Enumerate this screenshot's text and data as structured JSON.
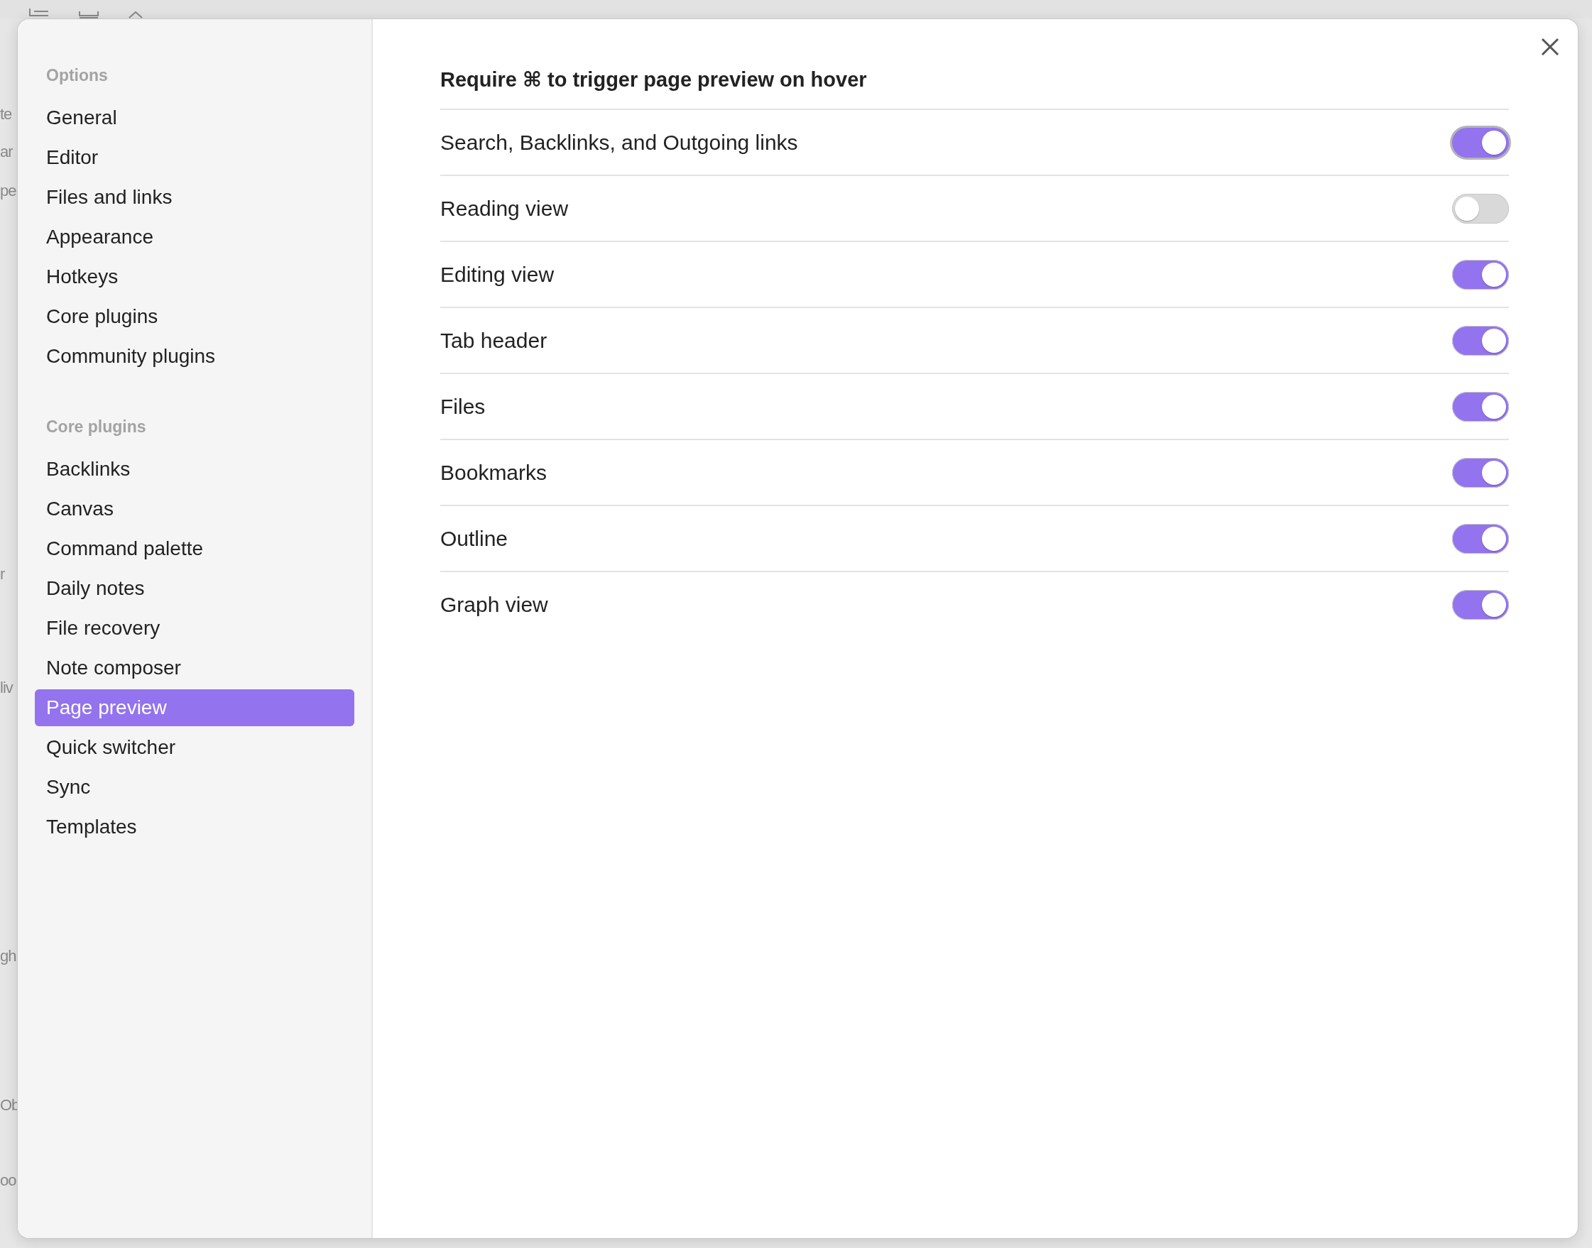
{
  "background": {
    "text_fragments": [
      "te",
      "ar",
      "pe",
      "r",
      "liv",
      "gh",
      "Ob",
      "oo"
    ]
  },
  "sidebar": {
    "sections": [
      {
        "title": "Options",
        "items": [
          {
            "label": "General",
            "selected": false
          },
          {
            "label": "Editor",
            "selected": false
          },
          {
            "label": "Files and links",
            "selected": false
          },
          {
            "label": "Appearance",
            "selected": false
          },
          {
            "label": "Hotkeys",
            "selected": false
          },
          {
            "label": "Core plugins",
            "selected": false
          },
          {
            "label": "Community plugins",
            "selected": false
          }
        ]
      },
      {
        "title": "Core plugins",
        "items": [
          {
            "label": "Backlinks",
            "selected": false
          },
          {
            "label": "Canvas",
            "selected": false
          },
          {
            "label": "Command palette",
            "selected": false
          },
          {
            "label": "Daily notes",
            "selected": false
          },
          {
            "label": "File recovery",
            "selected": false
          },
          {
            "label": "Note composer",
            "selected": false
          },
          {
            "label": "Page preview",
            "selected": true
          },
          {
            "label": "Quick switcher",
            "selected": false
          },
          {
            "label": "Sync",
            "selected": false
          },
          {
            "label": "Templates",
            "selected": false
          }
        ]
      }
    ]
  },
  "content": {
    "heading": "Require ⌘ to trigger page preview on hover",
    "settings": [
      {
        "label": "Search, Backlinks, and Outgoing links",
        "on": true,
        "focused": true
      },
      {
        "label": "Reading view",
        "on": false,
        "focused": false
      },
      {
        "label": "Editing view",
        "on": true,
        "focused": false
      },
      {
        "label": "Tab header",
        "on": true,
        "focused": false
      },
      {
        "label": "Files",
        "on": true,
        "focused": false
      },
      {
        "label": "Bookmarks",
        "on": true,
        "focused": false
      },
      {
        "label": "Outline",
        "on": true,
        "focused": false
      },
      {
        "label": "Graph view",
        "on": true,
        "focused": false
      }
    ]
  }
}
